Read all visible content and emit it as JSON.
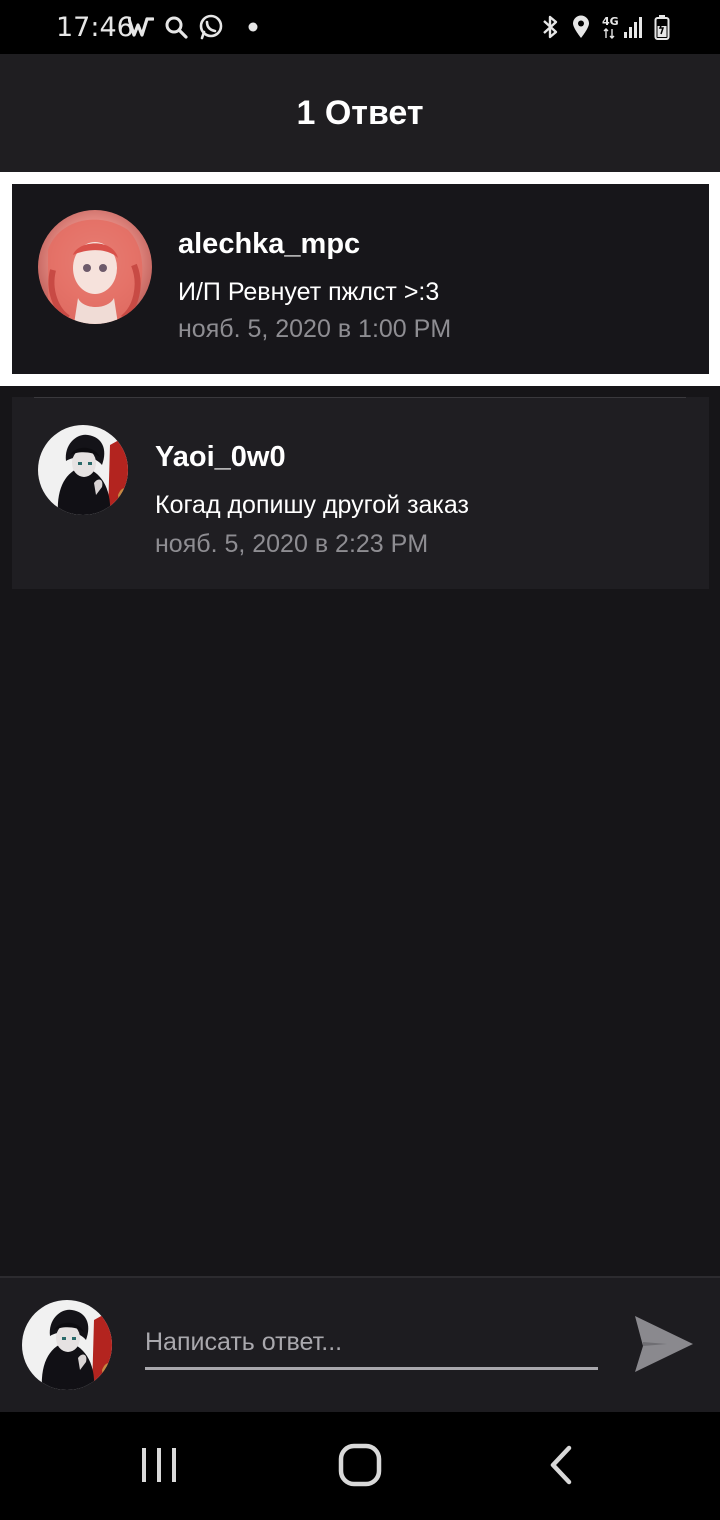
{
  "status_bar": {
    "time": "17:46",
    "left_icons": [
      "wattpad-icon",
      "search-icon",
      "whatsapp-icon",
      "dot-icon"
    ],
    "right_icons": [
      "bluetooth-icon",
      "location-icon",
      "4g-signal-icon",
      "battery-icon"
    ],
    "network_label": "4G"
  },
  "header": {
    "title": "1 Ответ"
  },
  "parent_comment": {
    "username": "alechka_mpc",
    "text": "И/П Ревнует пжлст >:3",
    "time": "нояб. 5, 2020 в 1:00 PM"
  },
  "replies": [
    {
      "username": "Yaoi_0w0",
      "text": "Когад допишу другой заказ",
      "time": "нояб. 5, 2020 в 2:23 PM"
    }
  ],
  "composer": {
    "placeholder": "Написать ответ..."
  },
  "nav_bar": {
    "buttons": [
      "recent-apps-icon",
      "home-icon",
      "back-icon"
    ]
  },
  "colors": {
    "background": "#161518",
    "header": "#1f1e21",
    "highlight_border": "#ffffff",
    "secondary_text": "#8e8d92"
  }
}
